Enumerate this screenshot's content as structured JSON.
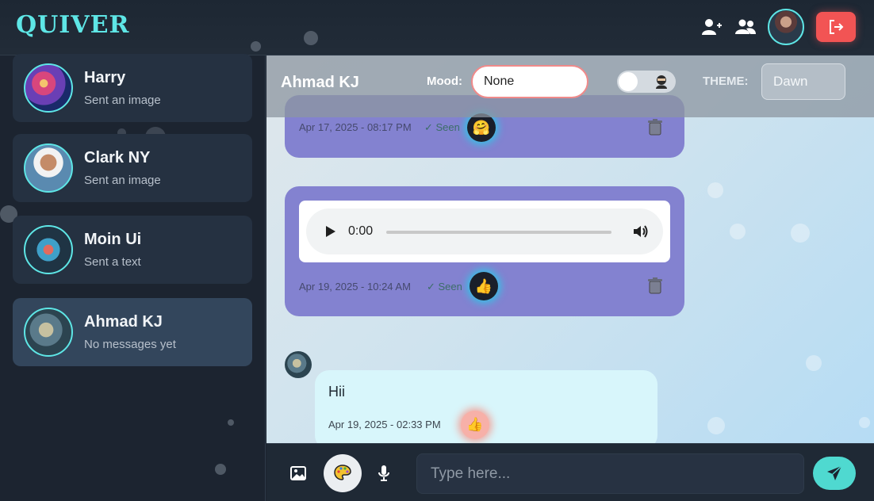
{
  "app": {
    "logo": "QUIVER"
  },
  "topbar": {
    "icons": [
      "add-user-icon",
      "group-icon",
      "profile-avatar",
      "logout-icon"
    ],
    "logout_color": "#f25454"
  },
  "sidebar": {
    "contacts": [
      {
        "name": "Harry",
        "subtitle": "Sent an image",
        "active": false
      },
      {
        "name": "Clark NY",
        "subtitle": "Sent an image",
        "active": false
      },
      {
        "name": "Moin Ui",
        "subtitle": "Sent a text",
        "active": false
      },
      {
        "name": "Ahmad KJ",
        "subtitle": "No messages yet",
        "active": true
      }
    ]
  },
  "chat": {
    "title": "Ahmad KJ",
    "mood_label": "Mood:",
    "mood_value": "None",
    "theme_label": "THEME:",
    "theme_value": "Dawn",
    "messages": [
      {
        "direction": "out",
        "type": "image",
        "timestamp": "Apr 17, 2025 - 08:17 PM",
        "status": "✓ Seen",
        "reaction": "🤗"
      },
      {
        "direction": "out",
        "type": "audio",
        "audio_time": "0:00",
        "timestamp": "Apr 19, 2025 - 10:24 AM",
        "status": "✓ Seen",
        "reaction": "👍"
      },
      {
        "direction": "in",
        "type": "text",
        "text": "Hii",
        "timestamp": "Apr 19, 2025 - 02:33 PM",
        "reaction": "👍"
      }
    ]
  },
  "composer": {
    "placeholder": "Type here...",
    "icons": [
      "image-icon",
      "palette-icon",
      "microphone-icon",
      "send-icon"
    ],
    "accent": "#4fd9d0"
  }
}
